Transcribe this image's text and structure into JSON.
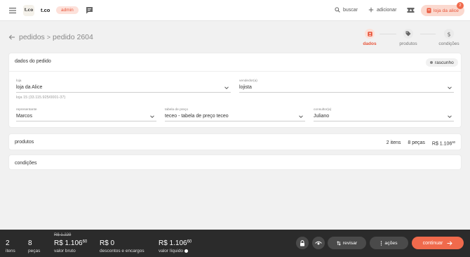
{
  "topbar": {
    "brand": "t.co",
    "logo_text": "t.co",
    "role": "admin",
    "search_label": "buscar",
    "add_label": "adicionar",
    "store_label": "loja da alice",
    "notification_count": "2"
  },
  "header": {
    "breadcrumb_parent": "pedidos",
    "breadcrumb_sep": ">",
    "breadcrumb_current": "pedido 2604"
  },
  "steps": [
    {
      "label": "dados",
      "active": true
    },
    {
      "label": "produtos",
      "active": false
    },
    {
      "label": "condições",
      "active": false
    }
  ],
  "order_data": {
    "title": "dados do pedido",
    "status": "rascunho",
    "store": {
      "label": "loja",
      "value": "loja da Alice",
      "hint": "loja 15 (33.115.925/0001-37)"
    },
    "seller": {
      "label": "vendedor(a)",
      "value": "lojista"
    },
    "representative": {
      "label": "representante",
      "value": "Marcos"
    },
    "price_table": {
      "label": "tabela de preço",
      "value": "teceo - tabela de preço teceo"
    },
    "consultant": {
      "label": "consultor(a)",
      "value": "Juliano"
    }
  },
  "products": {
    "title": "produtos",
    "items": "2 itens",
    "pieces": "8 peças",
    "total_int": "R$ 1.106",
    "total_cents": "60"
  },
  "conditions": {
    "title": "condições"
  },
  "bottom": {
    "items_value": "2",
    "items_label": "itens",
    "pieces_value": "8",
    "pieces_label": "peças",
    "gross_old": "R$ 1.229",
    "gross_int": "R$ 1.106",
    "gross_cents": "60",
    "gross_label": "valor bruto",
    "discounts_value": "R$ 0",
    "discounts_label": "descontos e encargos",
    "net_int": "R$ 1.106",
    "net_cents": "60",
    "net_label": "valor líquido",
    "review_label": "revisar",
    "actions_label": "ações",
    "continue_label": "continuar"
  },
  "colors": {
    "accent": "#f06a4c",
    "accent_light": "#fde0d8",
    "bottom_bar": "#2b2b2b"
  }
}
